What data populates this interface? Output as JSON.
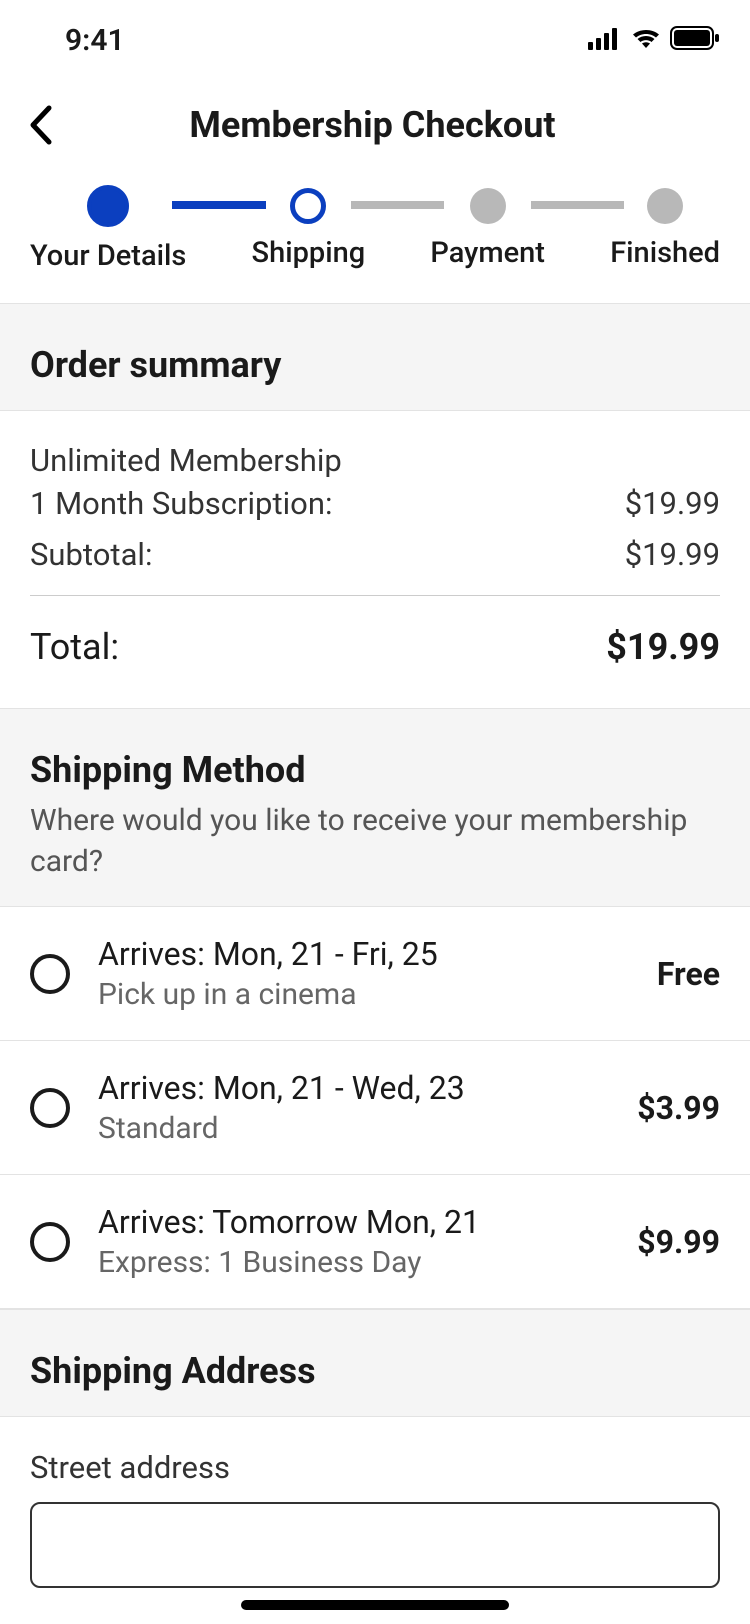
{
  "status": {
    "time": "9:41"
  },
  "header": {
    "title": "Membership Checkout"
  },
  "stepper": {
    "steps": [
      {
        "label": "Your Details"
      },
      {
        "label": "Shipping"
      },
      {
        "label": "Payment"
      },
      {
        "label": "Finished"
      }
    ]
  },
  "order_summary": {
    "title": "Order summary",
    "item_name": "Unlimited Membership",
    "item_desc": "1 Month Subscription:",
    "item_price": "$19.99",
    "subtotal_label": "Subtotal:",
    "subtotal_value": "$19.99",
    "total_label": "Total:",
    "total_value": "$19.99"
  },
  "shipping_method": {
    "title": "Shipping Method",
    "subtitle": "Where would you like to receive your membership card?",
    "options": [
      {
        "arrival": "Arrives: Mon, 21 - Fri, 25",
        "desc": "Pick up in a cinema",
        "price": "Free"
      },
      {
        "arrival": "Arrives: Mon, 21 - Wed, 23",
        "desc": "Standard",
        "price": "$3.99"
      },
      {
        "arrival": "Arrives: Tomorrow Mon, 21",
        "desc": "Express: 1 Business Day",
        "price": "$9.99"
      }
    ]
  },
  "shipping_address": {
    "title": "Shipping Address",
    "street_label": "Street address",
    "street_value": ""
  }
}
